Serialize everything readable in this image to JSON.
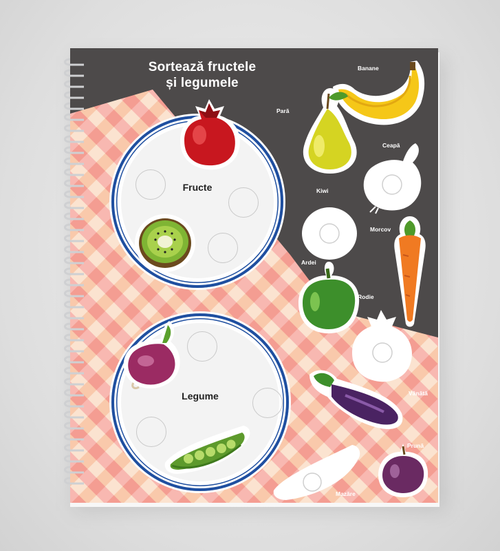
{
  "title_line1": "Sortează fructele",
  "title_line2": "și legumele",
  "plates": {
    "fruits_label": "Fructe",
    "vegetables_label": "Legume"
  },
  "stickers": {
    "banane": "Banane",
    "para": "Pară",
    "ceapa": "Ceapă",
    "kiwi": "Kiwi",
    "morcov": "Morcov",
    "ardei": "Ardei",
    "rodie": "Rodie",
    "vanata": "Vânătă",
    "pruna": "Prună",
    "mazare": "Mazăre"
  },
  "colors": {
    "page_background": "#4d4a4a",
    "plate_rim": "#1f4fa0",
    "tablecloth_pink": "#f4a7a7"
  }
}
